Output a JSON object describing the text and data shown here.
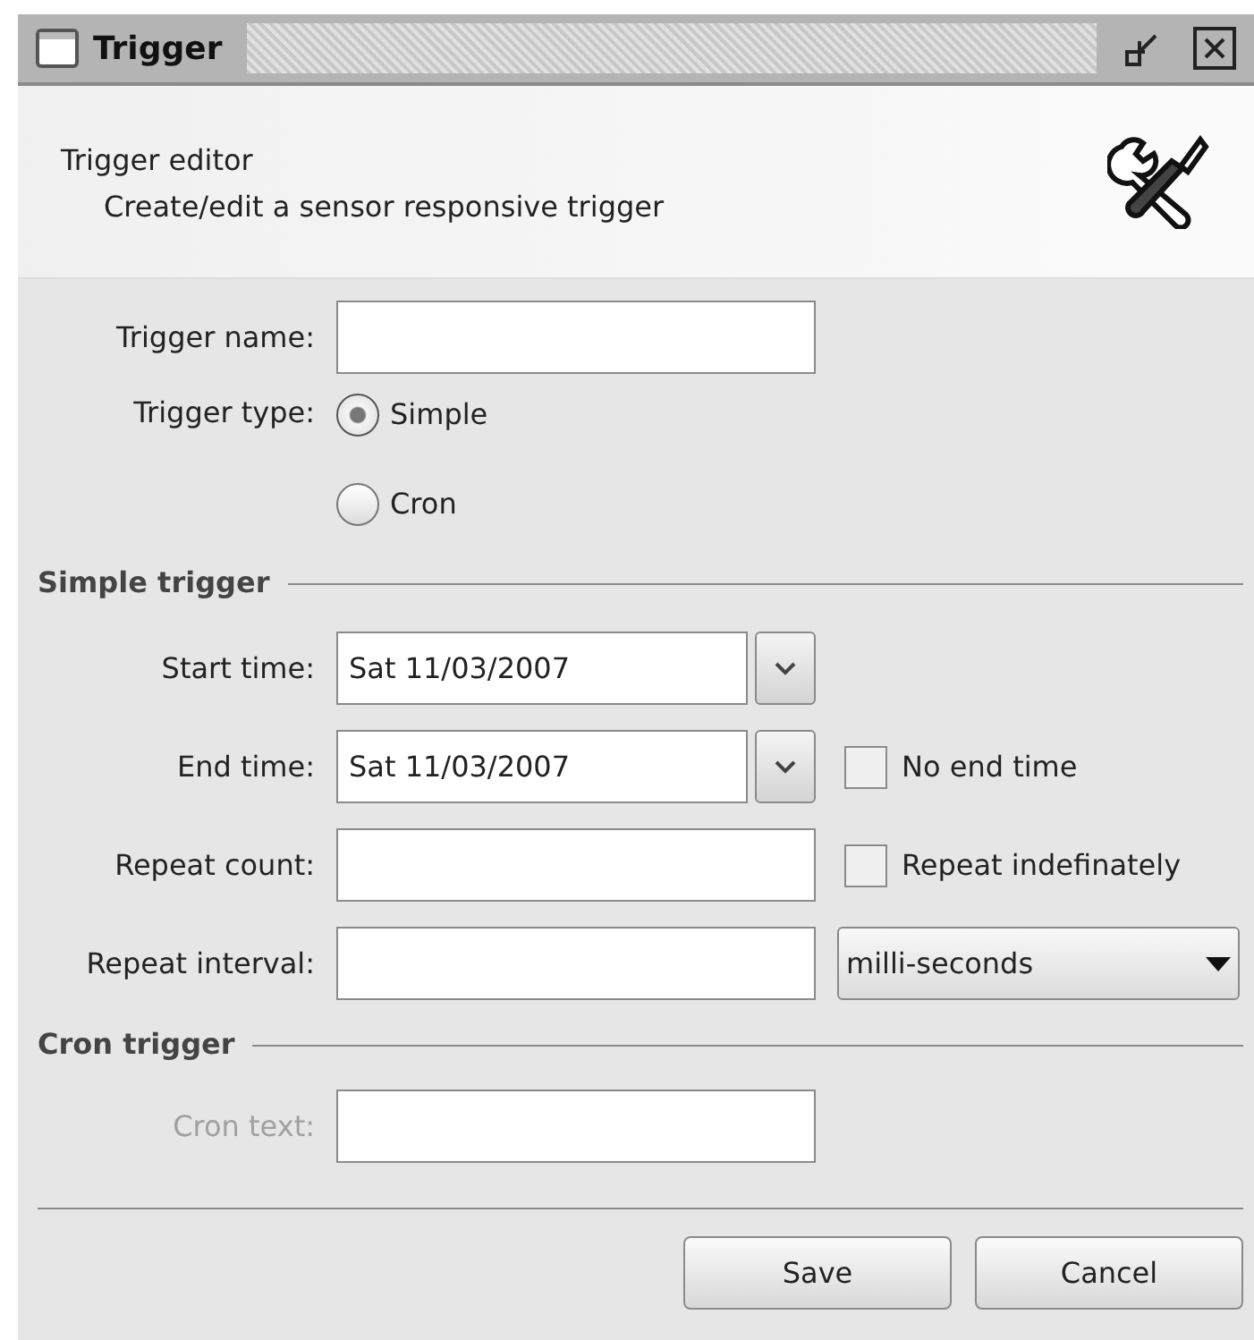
{
  "window": {
    "title": "Trigger"
  },
  "header": {
    "title": "Trigger editor",
    "subtitle": "Create/edit a sensor responsive trigger"
  },
  "trigger_name": {
    "label": "Trigger name:"
  },
  "trigger_type": {
    "label": "Trigger type:",
    "options": [
      {
        "label": "Simple",
        "selected": true
      },
      {
        "label": "Cron",
        "selected": false
      }
    ]
  },
  "simple_trigger": {
    "heading": "Simple trigger",
    "start_time": {
      "label": "Start time:",
      "value": "Sat 11/03/2007"
    },
    "end_time": {
      "label": "End time:",
      "value": "Sat 11/03/2007",
      "checkbox": {
        "label": "No end time",
        "checked": false
      }
    },
    "repeat_count": {
      "label": "Repeat count:",
      "checkbox": {
        "label": "Repeat indefinately",
        "checked": false
      }
    },
    "repeat_interval": {
      "label": "Repeat interval:",
      "unit": "milli-seconds"
    }
  },
  "cron_trigger": {
    "heading": "Cron trigger",
    "cron_text": {
      "label": "Cron text:",
      "disabled": true
    }
  },
  "buttons": [
    "Save",
    "Cancel"
  ]
}
